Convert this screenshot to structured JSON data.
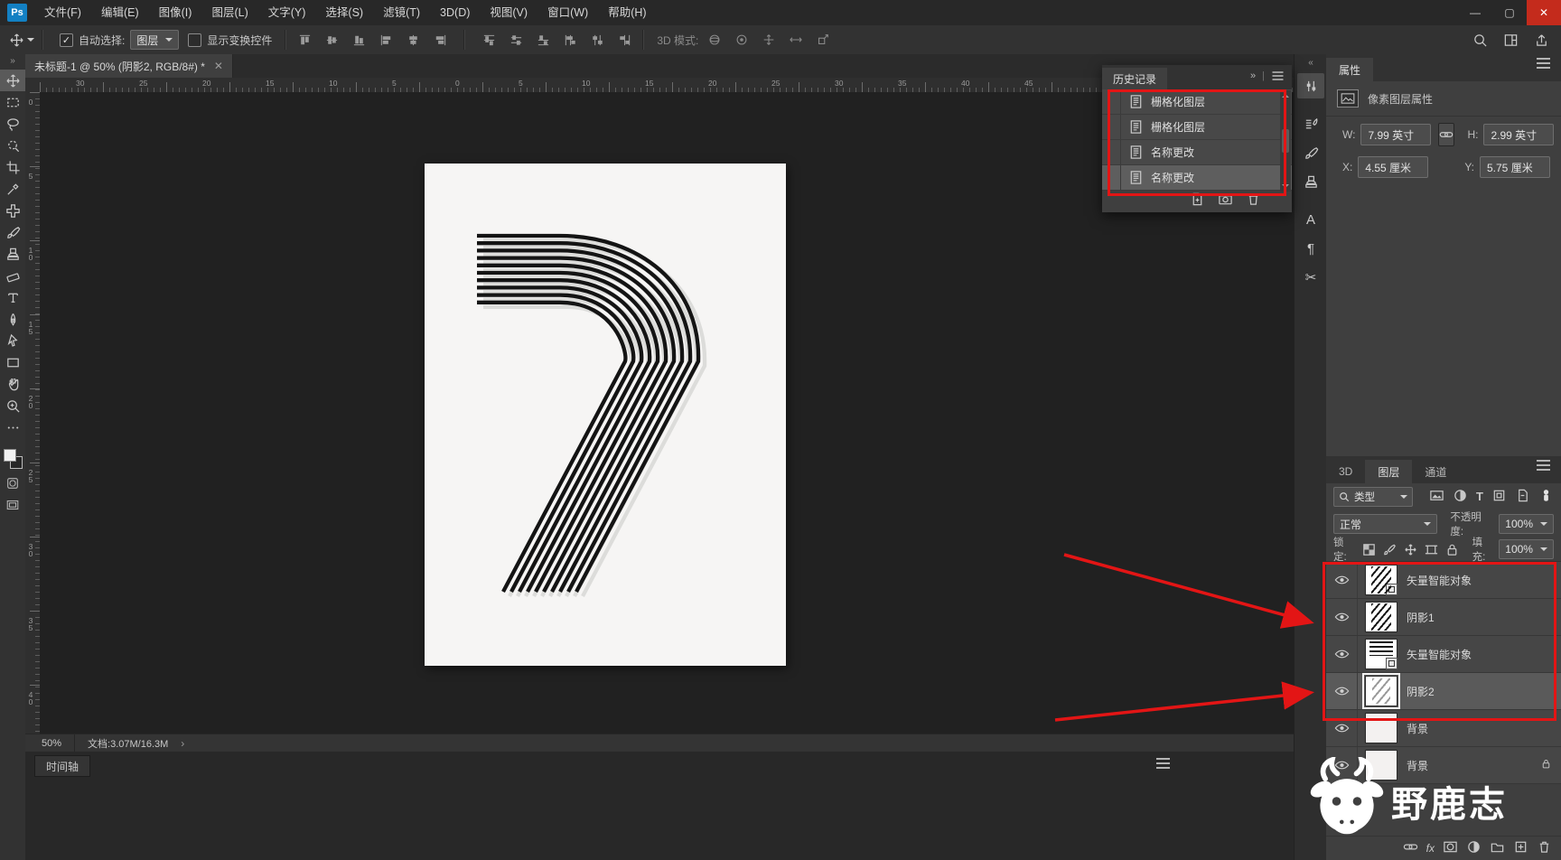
{
  "window": {
    "controls": [
      "minimize",
      "maximize",
      "close"
    ]
  },
  "menu_bar": {
    "logo": "Ps",
    "menus": [
      "文件(F)",
      "编辑(E)",
      "图像(I)",
      "图层(L)",
      "文字(Y)",
      "选择(S)",
      "滤镜(T)",
      "3D(D)",
      "视图(V)",
      "窗口(W)",
      "帮助(H)"
    ]
  },
  "options_bar": {
    "auto_select_label": "自动选择:",
    "auto_select_value": "图层",
    "show_transform_label": "显示变换控件",
    "mode_3d_label": "3D 模式:",
    "right_icons": [
      "search",
      "workspace-switcher",
      "share"
    ]
  },
  "document_tab": {
    "title": "未标题-1 @ 50% (阴影2, RGB/8#) *"
  },
  "toolbar": {
    "selected": "move",
    "tools": [
      "move",
      "rectangular-marquee",
      "lasso",
      "quick-selection",
      "crop",
      "eyedropper",
      "spot-healing-brush",
      "brush",
      "clone-stamp",
      "eraser",
      "horizontal-type",
      "pen",
      "path-selection",
      "rectangle-shape",
      "hand",
      "zoom",
      "more-tools"
    ]
  },
  "rulers": {
    "horizontal": [
      "30",
      "25",
      "20",
      "15",
      "10",
      "5",
      "0",
      "5",
      "10",
      "15",
      "20",
      "25",
      "30",
      "35",
      "40",
      "45"
    ],
    "vertical": [
      "0",
      "5",
      "10",
      "15",
      "20",
      "25",
      "30",
      "35",
      "40",
      "45"
    ]
  },
  "canvas": {
    "artwork": "striped numeral 7 poster",
    "stripe_count": 10,
    "zoom": "50%"
  },
  "status_bar": {
    "zoom": "50%",
    "document_info": "文档:3.07M/16.3M"
  },
  "timeline": {
    "tab_label": "时间轴"
  },
  "history_panel": {
    "tab_label": "历史记录",
    "items": [
      {
        "label": "栅格化图层",
        "selected": false
      },
      {
        "label": "栅格化图层",
        "selected": false
      },
      {
        "label": "名称更改",
        "selected": false
      },
      {
        "label": "名称更改",
        "selected": true
      }
    ],
    "footer_icons": [
      "new-document-from-state",
      "new-snapshot",
      "delete-state"
    ]
  },
  "dock_strip": {
    "icons": [
      "properties",
      "brush-settings",
      "brushes",
      "clone-source",
      "character",
      "paragraph",
      "annotate"
    ]
  },
  "properties_panel": {
    "tab_label": "属性",
    "object_type": "像素图层属性",
    "fields": {
      "w_label": "W:",
      "w_value": "7.99 英寸",
      "h_label": "H:",
      "h_value": "2.99 英寸",
      "x_label": "X:",
      "x_value": "4.55 厘米",
      "y_label": "Y:",
      "y_value": "5.75 厘米"
    }
  },
  "layers_panel": {
    "tabs": [
      "3D",
      "图层",
      "通道"
    ],
    "active_tab": "图层",
    "filter_label": "类型",
    "filter_icons": [
      "image-filter",
      "adjustment-filter",
      "type-filter",
      "shape-filter",
      "smart-object-filter",
      "filter-toggle"
    ],
    "blend_mode": "正常",
    "opacity_label": "不透明度:",
    "opacity_value": "100%",
    "lock_label": "锁定:",
    "lock_icons": [
      "lock-transparent",
      "lock-paint",
      "lock-position",
      "lock-artboard",
      "lock-all"
    ],
    "fill_label": "填充:",
    "fill_value": "100%",
    "layers": [
      {
        "name": "矢量智能对象",
        "smart": true,
        "thumb": "diagonal-stripes",
        "selected": false,
        "locked": false
      },
      {
        "name": "阴影1",
        "smart": false,
        "thumb": "diagonal-stripes",
        "selected": false,
        "locked": false
      },
      {
        "name": "矢量智能对象",
        "smart": true,
        "thumb": "horizontal-stripes",
        "selected": false,
        "locked": false
      },
      {
        "name": "阴影2",
        "smart": false,
        "thumb": "selection-brackets",
        "selected": true,
        "locked": false
      },
      {
        "name": "背景",
        "smart": false,
        "thumb": "white",
        "selected": false,
        "locked": false
      },
      {
        "name": "背景",
        "smart": false,
        "thumb": "white",
        "selected": false,
        "locked": true
      }
    ],
    "footer_icons": [
      "link-layers",
      "layer-effects",
      "layer-mask",
      "adjustment-layer",
      "layer-group",
      "new-layer",
      "delete-layer"
    ]
  },
  "annotations": {
    "color": "#e31515",
    "highlight_rects": [
      "history-steps",
      "shadow-layers"
    ],
    "arrows": [
      "arrow-to-shadow1-layer",
      "arrow-to-shadow2-layer"
    ]
  },
  "watermark": {
    "text": "野鹿志"
  }
}
